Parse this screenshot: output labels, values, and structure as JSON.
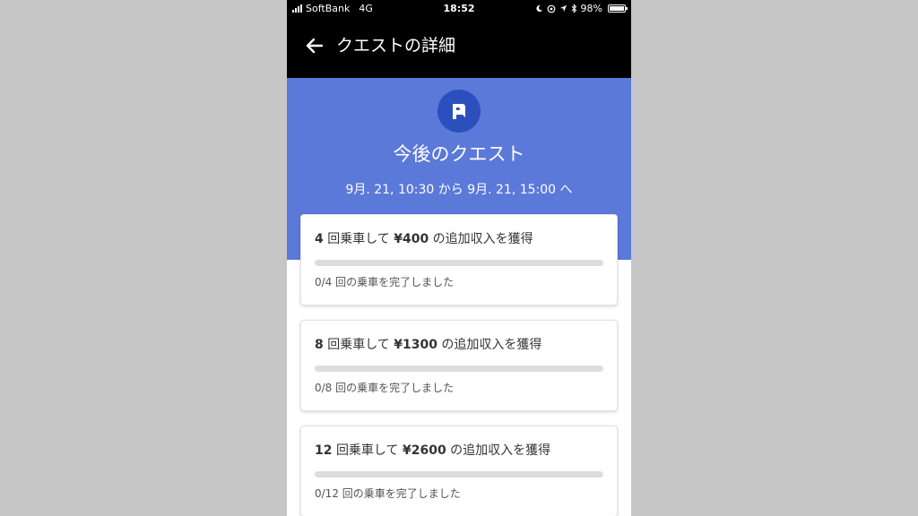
{
  "status_bar": {
    "carrier": "SoftBank",
    "network": "4G",
    "time": "18:52",
    "battery_percent": "98%",
    "battery_level": 0.98,
    "icons": [
      "moon-icon",
      "location-lock-icon",
      "location-arrow-icon",
      "bluetooth-icon",
      "battery-icon"
    ]
  },
  "app_bar": {
    "title": "クエストの詳細",
    "back_icon": "arrow-left-icon"
  },
  "hero": {
    "icon": "quest-flag-icon",
    "title": "今後のクエスト",
    "start": "9月. 21, 10:30",
    "from_word": "から",
    "end": "9月. 21, 15:00",
    "to_word": "へ"
  },
  "quests": [
    {
      "trips": "4",
      "trips_word": "回乗車して",
      "reward": "¥400",
      "reward_suffix": "の追加収入を獲得",
      "progress": 0,
      "status": "0/4 回の乗車を完了しました"
    },
    {
      "trips": "8",
      "trips_word": "回乗車して",
      "reward": "¥1300",
      "reward_suffix": "の追加収入を獲得",
      "progress": 0,
      "status": "0/8 回の乗車を完了しました"
    },
    {
      "trips": "12",
      "trips_word": "回乗車して",
      "reward": "¥2600",
      "reward_suffix": "の追加収入を獲得",
      "progress": 0,
      "status": "0/12 回の乗車を完了しました"
    }
  ],
  "colors": {
    "hero_blue": "#5b79d9",
    "icon_blue": "#2c4fbe",
    "header_black": "#000000",
    "backdrop_gray": "#c6c6c6"
  }
}
